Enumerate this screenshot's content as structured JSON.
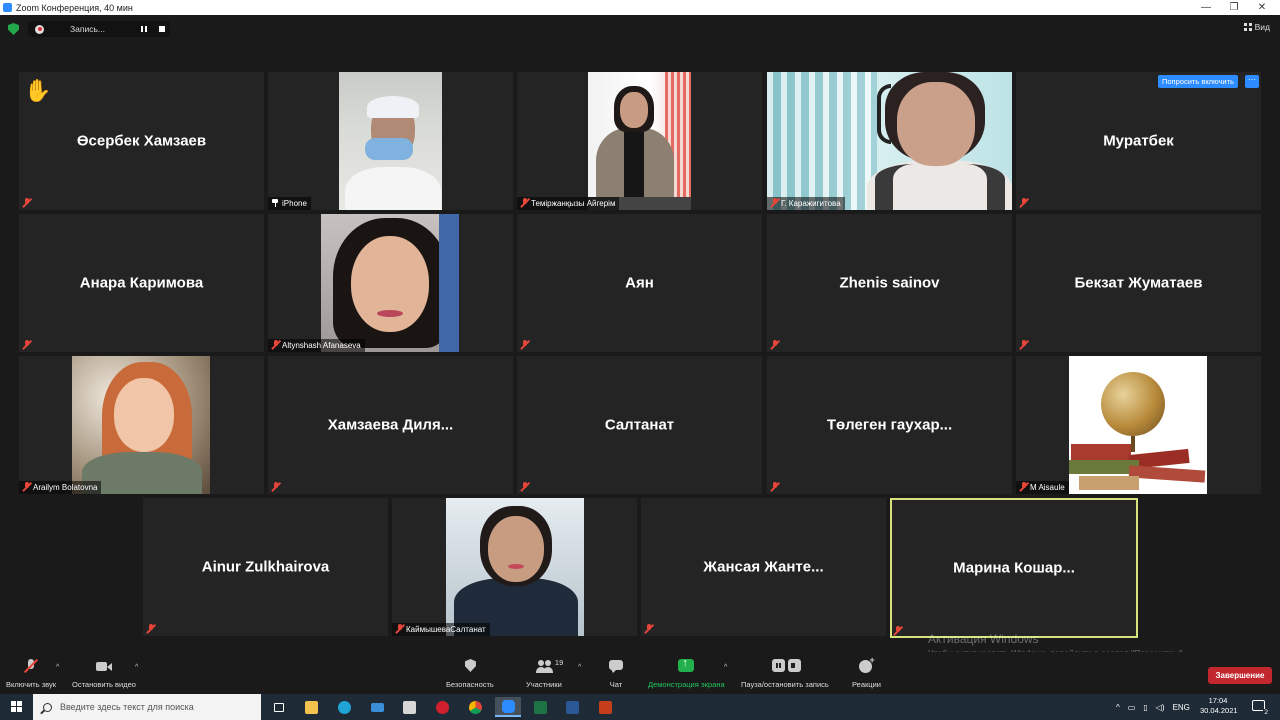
{
  "window": {
    "title": "Zoom Конференция, 40 мин"
  },
  "top_bar": {
    "recording_label": "Запись...",
    "view_label": "Вид"
  },
  "tile_actions": {
    "ask_to_unmute": "Попросить включить",
    "more": "···"
  },
  "participants": [
    {
      "id": "p1",
      "name": "Өсербек Хамзаев",
      "video": false,
      "hand_raised": true
    },
    {
      "id": "p2",
      "caption": "iPhone",
      "video": true
    },
    {
      "id": "p3",
      "caption": "Теміржанқызы Айгерім",
      "video": true
    },
    {
      "id": "p4",
      "caption": "Г. Каражигитова",
      "video": true
    },
    {
      "id": "p5",
      "name": "Муратбек",
      "video": false
    },
    {
      "id": "p6",
      "name": "Анара Каримова",
      "video": false
    },
    {
      "id": "p7",
      "caption": "Altynshash Afanaseva",
      "video": true
    },
    {
      "id": "p8",
      "name": "Аян",
      "video": false
    },
    {
      "id": "p9",
      "name": "Zhenis sainov",
      "video": false
    },
    {
      "id": "p10",
      "name": "Бекзат Жуматаев",
      "video": false
    },
    {
      "id": "p11",
      "caption": "Arailym Bolatovna",
      "video": true
    },
    {
      "id": "p12",
      "name": "Хамзаева Диля...",
      "video": false
    },
    {
      "id": "p13",
      "name": "Салтанат",
      "video": false
    },
    {
      "id": "p14",
      "name": "Төлеген гаухар...",
      "video": false
    },
    {
      "id": "p15",
      "caption": "M Aisaule",
      "video": true
    },
    {
      "id": "p16",
      "name": "Ainur Zulkhairova",
      "video": false
    },
    {
      "id": "p17",
      "caption": "КаймышеваСалтанат",
      "video": true
    },
    {
      "id": "p18",
      "name": "Жансая Жанте...",
      "video": false
    },
    {
      "id": "p19",
      "name": "Марина Кошар...",
      "video": false,
      "active_speaker": true
    }
  ],
  "windows_activation": {
    "title": "Активация Windows",
    "subtitle": "Чтобы активировать Windows, перейдите в раздел \"Параметры\"."
  },
  "toolbar": {
    "mute": "Включить звук",
    "video": "Остановить видео",
    "security": "Безопасность",
    "participants": "Участники",
    "participants_count": "19",
    "chat": "Чат",
    "share": "Демонстрация экрана",
    "record": "Пауза/остановить запись",
    "reactions": "Реакции",
    "end": "Завершение"
  },
  "taskbar": {
    "search_placeholder": "Введите здесь текст для поиска",
    "lang": "ENG",
    "time": "17:04",
    "date": "30.04.2021",
    "notifications": "2"
  },
  "colors": {
    "accent_blue": "#2d8cff",
    "share_green": "#22b14c",
    "end_red": "#c1272d",
    "active_speaker": "#d7e27a",
    "muted_red": "#e6463a"
  }
}
